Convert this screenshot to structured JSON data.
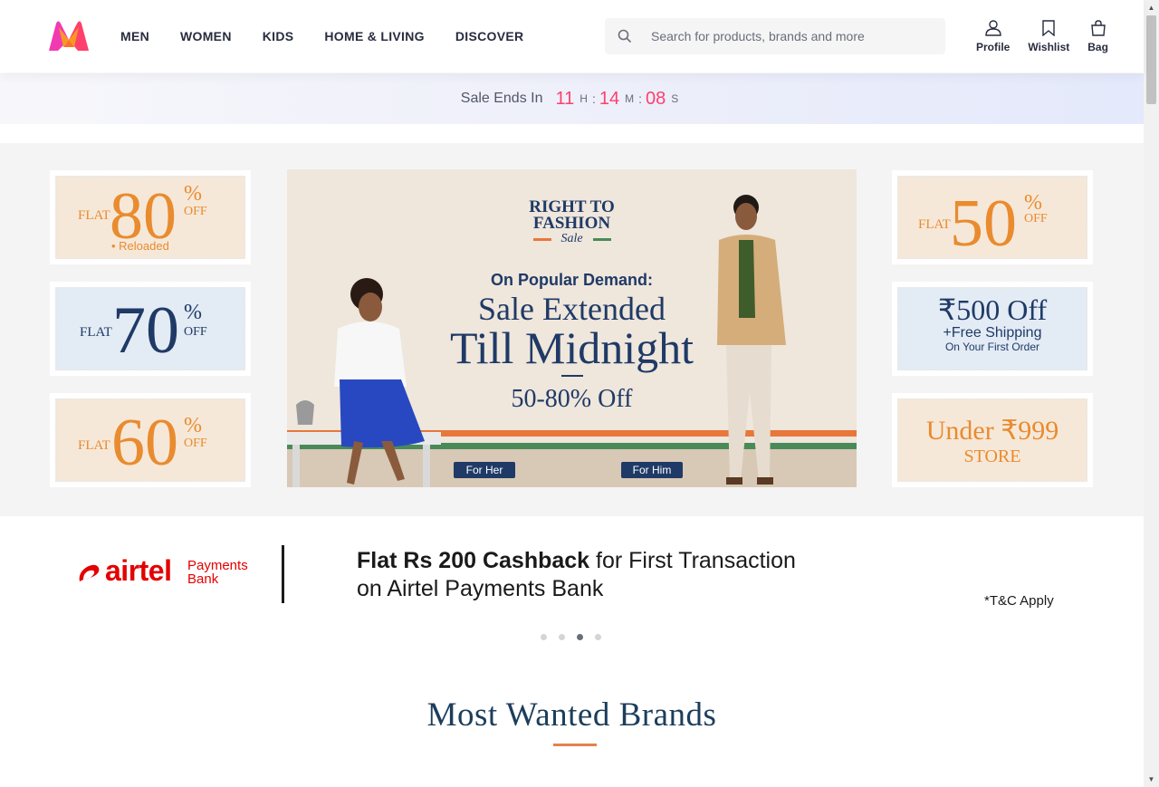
{
  "header": {
    "nav": [
      "MEN",
      "WOMEN",
      "KIDS",
      "HOME & LIVING",
      "DISCOVER"
    ],
    "search_placeholder": "Search for products, brands and more",
    "actions": {
      "profile": "Profile",
      "wishlist": "Wishlist",
      "bag": "Bag"
    },
    "brand_color": "#ff3f6c"
  },
  "sale": {
    "label": "Sale Ends In",
    "hours": "11",
    "hours_unit": "H",
    "minutes": "14",
    "minutes_unit": "M",
    "seconds": "08",
    "seconds_unit": "S",
    "sep": ":"
  },
  "tiles": {
    "t80": {
      "flat": "FLAT",
      "value": "80",
      "pct": "%",
      "off": "OFF",
      "note": "• Reloaded"
    },
    "t70": {
      "flat": "FLAT",
      "value": "70",
      "pct": "%",
      "off": "OFF"
    },
    "t60": {
      "flat": "FLAT",
      "value": "60",
      "pct": "%",
      "off": "OFF"
    },
    "t50": {
      "flat": "FLAT",
      "value": "50",
      "pct": "%",
      "off": "OFF"
    },
    "t500": {
      "line1": "₹500 Off",
      "line2": "+Free Shipping",
      "line3": "On Your First Order"
    },
    "t999": {
      "line1": "Under ₹999",
      "line2": "STORE"
    }
  },
  "hero": {
    "title1": "RIGHT TO",
    "title2": "FASHION",
    "title3": "Sale",
    "sub": "On Popular Demand:",
    "h1": "Sale Extended",
    "h2": "Till Midnight",
    "h3": "50-80% Off",
    "btn_her": "For Her",
    "btn_him": "For Him"
  },
  "airtel": {
    "brand": "airtel",
    "brand2": "Payments",
    "brand3": "Bank",
    "bold": "Flat Rs 200 Cashback",
    "rest": " for First Transaction",
    "line2": "on Airtel Payments Bank",
    "tc": "*T&C Apply"
  },
  "carousel": {
    "active_index": 2,
    "count": 4
  },
  "section": {
    "title": "Most Wanted Brands"
  }
}
